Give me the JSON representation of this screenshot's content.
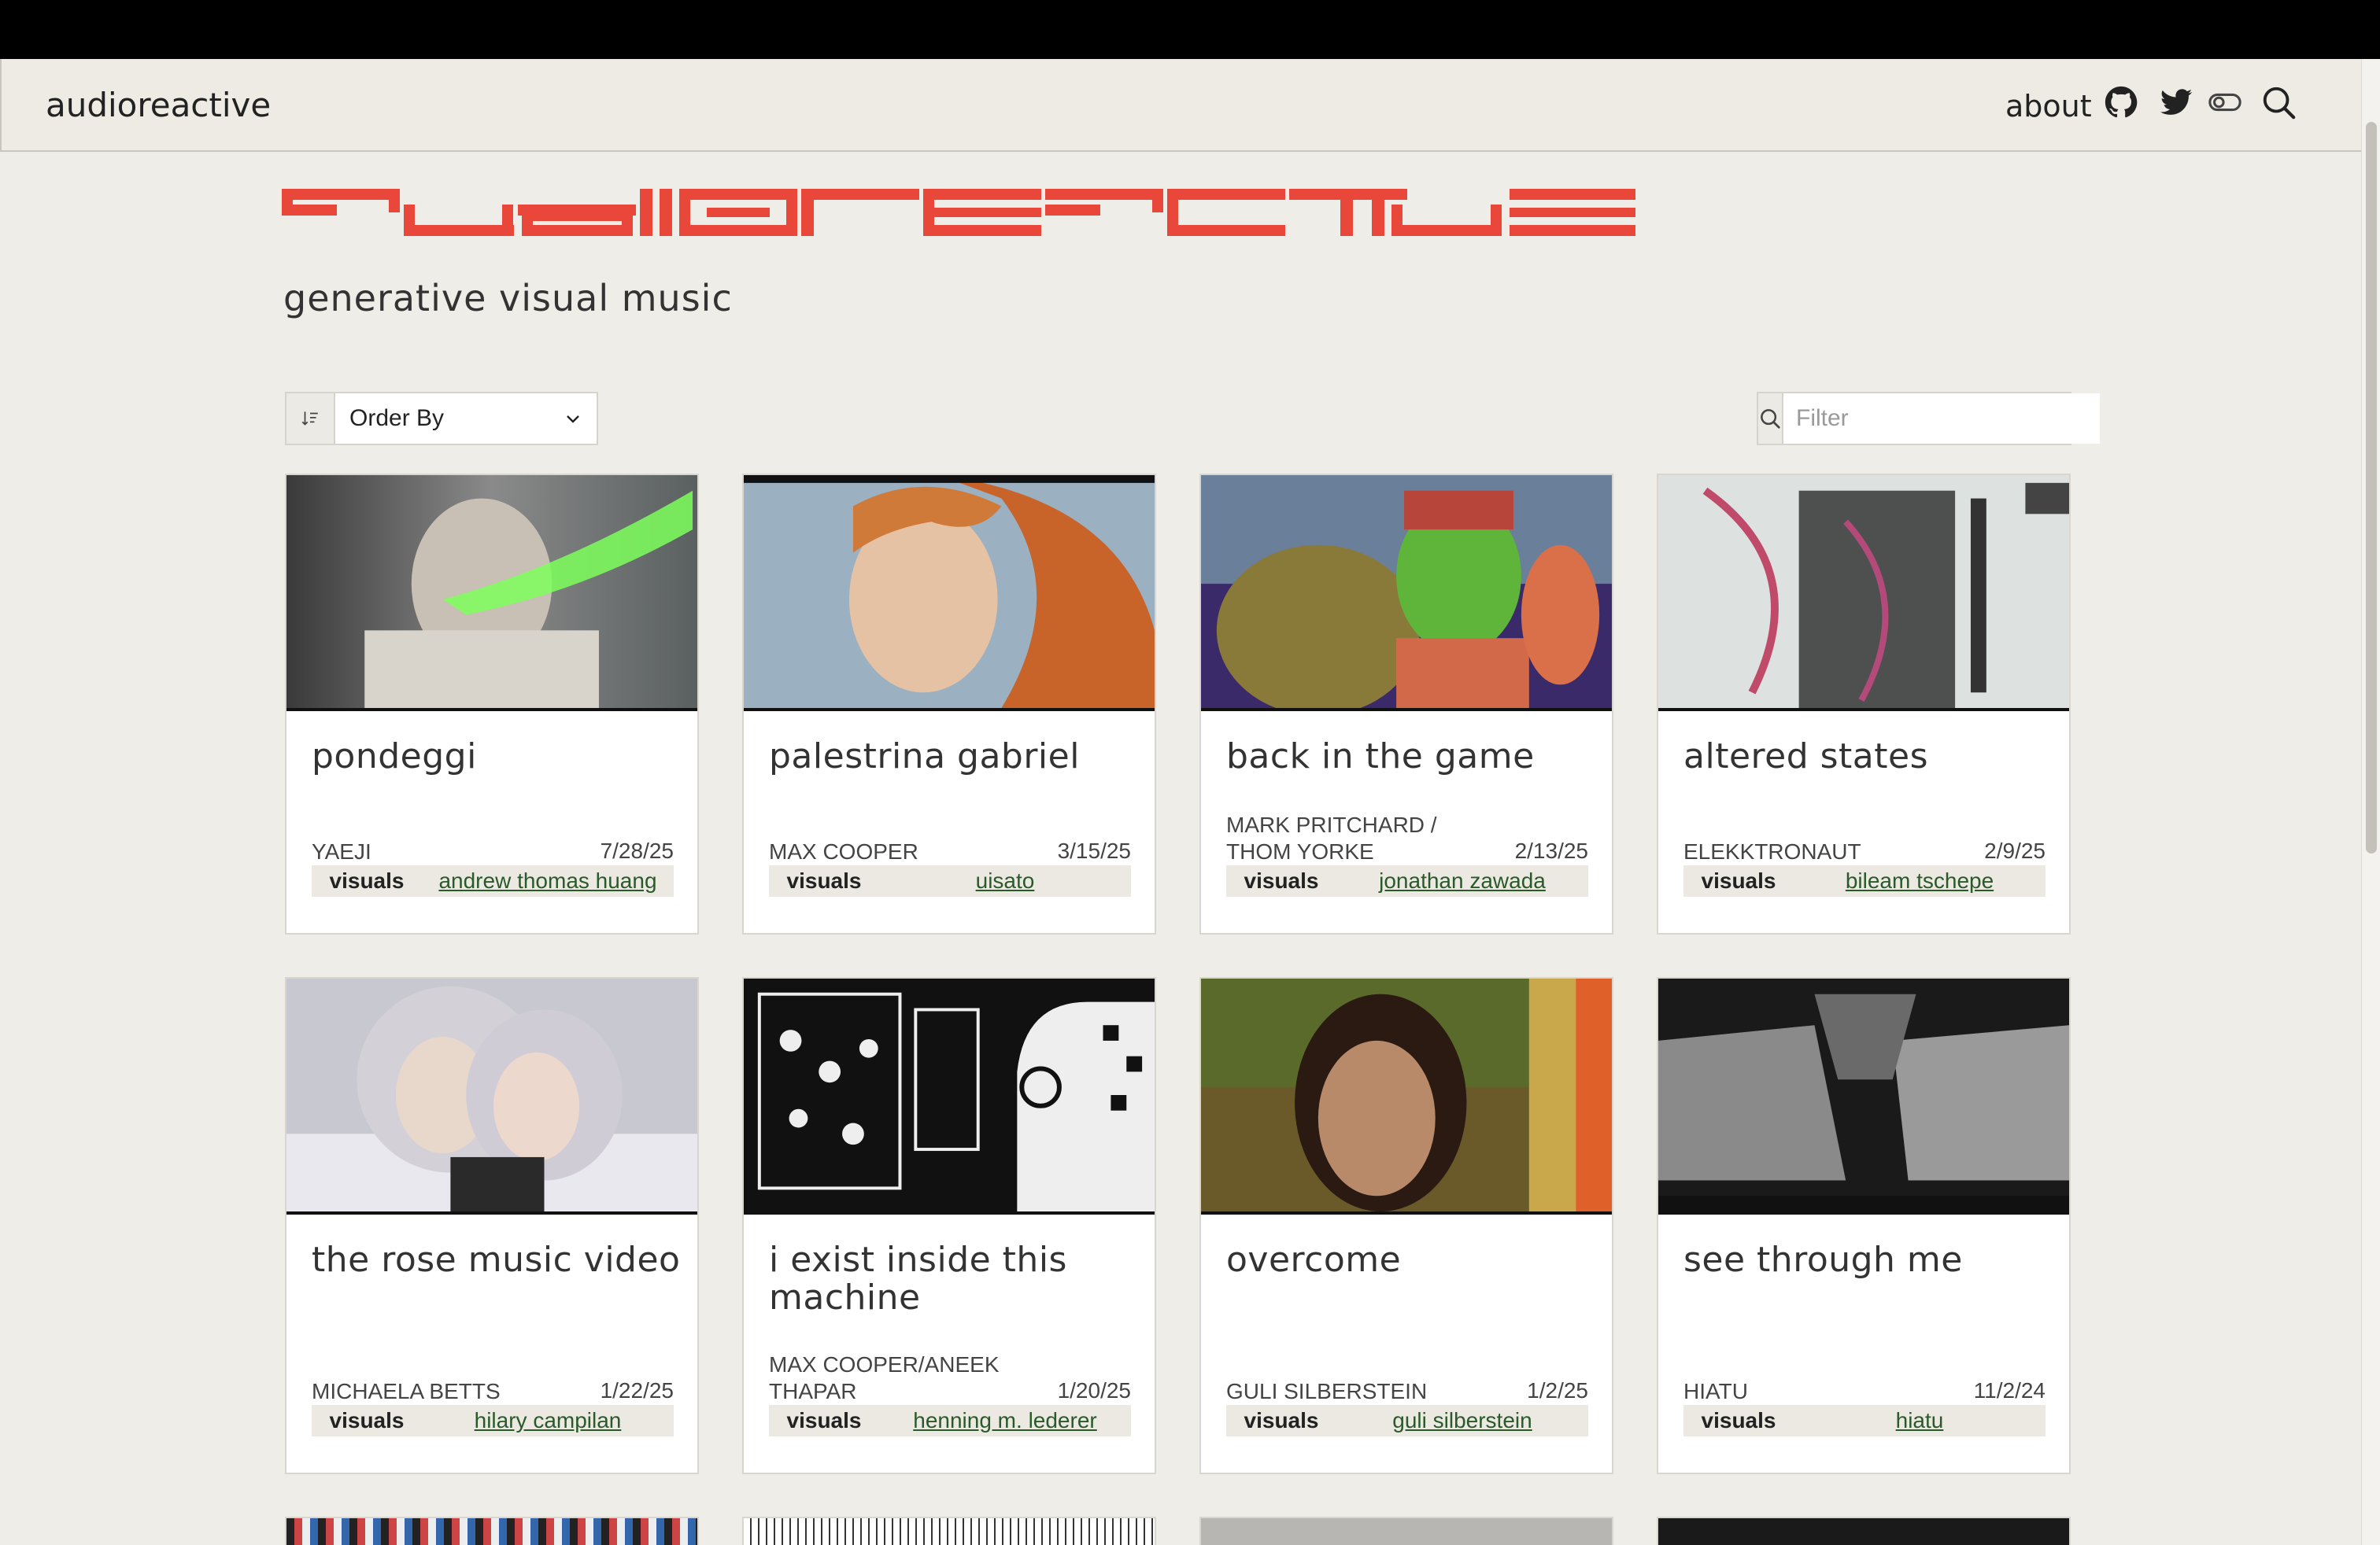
{
  "nav": {
    "brand": "audioreactive",
    "about": "about",
    "icons": [
      "github-icon",
      "twitter-icon",
      "theme-toggle-icon",
      "search-icon"
    ]
  },
  "hero": {
    "logo_text": "audioreactive",
    "tagline": "generative visual music",
    "logo_color": "#e8473a"
  },
  "controls": {
    "order_by_label": "Order By",
    "filter_placeholder": "Filter"
  },
  "cards": [
    {
      "title": "pondeggi",
      "artist": "YAEJI",
      "date": "7/28/25",
      "visuals_label": "visuals",
      "visuals_by": "andrew thomas huang"
    },
    {
      "title": "palestrina gabriel",
      "artist": "MAX COOPER",
      "date": "3/15/25",
      "visuals_label": "visuals",
      "visuals_by": "uisato"
    },
    {
      "title": "back in the game",
      "artist": "MARK PRITCHARD / THOM YORKE",
      "date": "2/13/25",
      "visuals_label": "visuals",
      "visuals_by": "jonathan zawada"
    },
    {
      "title": "altered states",
      "artist": "ELEKKTRONAUT",
      "date": "2/9/25",
      "visuals_label": "visuals",
      "visuals_by": "bileam tschepe"
    },
    {
      "title": "the rose music video",
      "artist": "MICHAELA BETTS",
      "date": "1/22/25",
      "visuals_label": "visuals",
      "visuals_by": "hilary campilan"
    },
    {
      "title": "i exist inside this machine",
      "artist": "MAX COOPER/ANEEK THAPAR",
      "date": "1/20/25",
      "visuals_label": "visuals",
      "visuals_by": "henning m. lederer"
    },
    {
      "title": "overcome",
      "artist": "GULI SILBERSTEIN",
      "date": "1/2/25",
      "visuals_label": "visuals",
      "visuals_by": "guli silberstein"
    },
    {
      "title": "see through me",
      "artist": "HIATU",
      "date": "11/2/24",
      "visuals_label": "visuals",
      "visuals_by": "hiatu"
    }
  ]
}
